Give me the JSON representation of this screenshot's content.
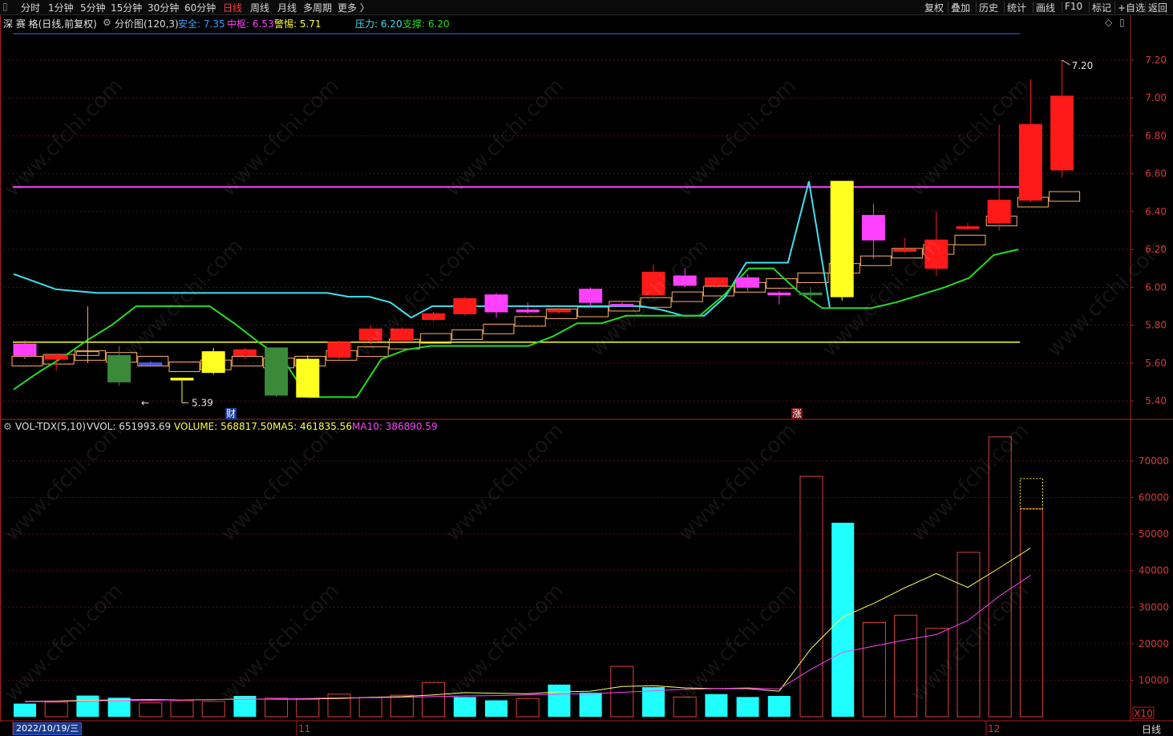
{
  "toolbar": {
    "left_items": [
      "分时",
      "1分钟",
      "5分钟",
      "15分钟",
      "30分钟",
      "60分钟",
      "日线",
      "周线",
      "月线",
      "多周期",
      "更多 〉"
    ],
    "active_item": "日线",
    "right_items": [
      "复权",
      "叠加",
      "历史",
      "统计",
      "画线",
      "F10",
      "标记",
      "+自选",
      "返回"
    ]
  },
  "main_header": {
    "stock": "深 赛 格(日线,前复权)",
    "indicator": "分价图(120,3)",
    "safe_label": "安全: 7.35",
    "mid_label": "中枢: 6.53",
    "warn_label": "警惕: 5.71",
    "pressure_label": "压力: 6.20",
    "support_label": "支撑: 6.20"
  },
  "vol_header": {
    "name": "VOL-TDX(5,10)",
    "vvol": "VVOL: 651993.69",
    "volume": "VOLUME: 568817.50",
    "ma5": "MA5: 461835.56",
    "ma10": "MA10: 386890.59"
  },
  "annotations": {
    "high_label": "7.20",
    "low_label": "5.39",
    "fin_marker": "财",
    "up_marker": "涨"
  },
  "price_axis": [
    "7.20",
    "7.00",
    "6.80",
    "6.60",
    "6.40",
    "6.20",
    "6.00",
    "5.80",
    "5.60",
    "5.40"
  ],
  "volume_axis": [
    "70000",
    "60000",
    "50000",
    "40000",
    "30000",
    "20000",
    "10000"
  ],
  "volume_unit": "X10",
  "date_box": "2022/10/19/三",
  "month_labels": [
    "11",
    "12"
  ],
  "period_label": "日线",
  "watermark": "www.cfchi.com",
  "colors": {
    "up": "#ff1a1a",
    "down": "#3a8a3a",
    "magenta": "#ff40ff",
    "yellow": "#ffff20",
    "cyan": "#20ffff",
    "green_line": "#22dd22",
    "cyan_line": "#40e0f0",
    "axis_red": "#d63a3a"
  },
  "chart_data": {
    "type": "candlestick",
    "price": {
      "ylim": [
        5.3,
        7.4
      ],
      "candles": [
        {
          "open": 5.7,
          "close": 5.64,
          "high": 5.72,
          "low": 5.62,
          "color": "magenta"
        },
        {
          "open": 5.64,
          "close": 5.62,
          "high": 5.65,
          "low": 5.56,
          "color": "red"
        },
        {
          "open": 5.64,
          "close": 5.66,
          "high": 5.9,
          "low": 5.6,
          "color": "outline"
        },
        {
          "open": 5.64,
          "close": 5.5,
          "high": 5.69,
          "low": 5.48,
          "color": "green"
        },
        {
          "open": 5.6,
          "close": 5.59,
          "high": 5.61,
          "low": 5.58,
          "color": "blue"
        },
        {
          "open": 5.52,
          "close": 5.51,
          "high": 5.52,
          "low": 5.39,
          "color": "yellow"
        },
        {
          "open": 5.55,
          "close": 5.66,
          "high": 5.68,
          "low": 5.54,
          "color": "yellow"
        },
        {
          "open": 5.64,
          "close": 5.67,
          "high": 5.68,
          "low": 5.62,
          "color": "red"
        },
        {
          "open": 5.68,
          "close": 5.43,
          "high": 5.68,
          "low": 5.42,
          "color": "green"
        },
        {
          "open": 5.62,
          "close": 5.42,
          "high": 5.64,
          "low": 5.42,
          "color": "yellow"
        },
        {
          "open": 5.63,
          "close": 5.71,
          "high": 5.72,
          "low": 5.62,
          "color": "red"
        },
        {
          "open": 5.72,
          "close": 5.78,
          "high": 5.8,
          "low": 5.7,
          "color": "red"
        },
        {
          "open": 5.72,
          "close": 5.78,
          "high": 5.79,
          "low": 5.72,
          "color": "red"
        },
        {
          "open": 5.83,
          "close": 5.86,
          "high": 5.87,
          "low": 5.82,
          "color": "red"
        },
        {
          "open": 5.86,
          "close": 5.94,
          "high": 5.95,
          "low": 5.85,
          "color": "red"
        },
        {
          "open": 5.87,
          "close": 5.96,
          "high": 5.97,
          "low": 5.84,
          "color": "magenta"
        },
        {
          "open": 5.87,
          "close": 5.88,
          "high": 5.92,
          "low": 5.86,
          "color": "magenta"
        },
        {
          "open": 5.87,
          "close": 5.88,
          "high": 5.89,
          "low": 5.86,
          "color": "red"
        },
        {
          "open": 5.92,
          "close": 5.99,
          "high": 6.0,
          "low": 5.9,
          "color": "magenta"
        },
        {
          "open": 5.91,
          "close": 5.91,
          "high": 5.92,
          "low": 5.9,
          "color": "magenta"
        },
        {
          "open": 5.96,
          "close": 6.08,
          "high": 6.12,
          "low": 5.94,
          "color": "red"
        },
        {
          "open": 6.06,
          "close": 6.01,
          "high": 6.1,
          "low": 6.0,
          "color": "magenta"
        },
        {
          "open": 6.01,
          "close": 6.05,
          "high": 6.05,
          "low": 6.0,
          "color": "red"
        },
        {
          "open": 6.0,
          "close": 6.05,
          "high": 6.07,
          "low": 5.98,
          "color": "magenta"
        },
        {
          "open": 5.97,
          "close": 5.96,
          "high": 5.98,
          "low": 5.91,
          "color": "magenta"
        },
        {
          "open": 5.96,
          "close": 5.97,
          "high": 6.0,
          "low": 5.92,
          "color": "green"
        },
        {
          "open": 5.95,
          "close": 6.56,
          "high": 6.56,
          "low": 5.93,
          "color": "yellow"
        },
        {
          "open": 6.38,
          "close": 6.25,
          "high": 6.44,
          "low": 6.15,
          "color": "magenta"
        },
        {
          "open": 6.19,
          "close": 6.2,
          "high": 6.26,
          "low": 6.18,
          "color": "red"
        },
        {
          "open": 6.1,
          "close": 6.25,
          "high": 6.4,
          "low": 6.06,
          "color": "red"
        },
        {
          "open": 6.31,
          "close": 6.32,
          "high": 6.34,
          "low": 6.3,
          "color": "red"
        },
        {
          "open": 6.34,
          "close": 6.46,
          "high": 6.86,
          "low": 6.3,
          "color": "red"
        },
        {
          "open": 6.46,
          "close": 6.86,
          "high": 7.1,
          "low": 6.45,
          "color": "red"
        },
        {
          "open": 6.62,
          "close": 7.01,
          "high": 7.2,
          "low": 6.58,
          "color": "red"
        }
      ],
      "lines": {
        "magenta_level": 6.53,
        "yellow_level": 5.71,
        "blue_level": 7.35,
        "green_line": [
          5.46,
          5.55,
          5.63,
          5.72,
          5.8,
          5.9,
          5.9,
          5.9,
          5.9,
          5.81,
          5.71,
          5.62,
          5.42,
          5.42,
          5.42,
          5.62,
          5.67,
          5.69,
          5.69,
          5.69,
          5.69,
          5.69,
          5.74,
          5.81,
          5.81,
          5.85,
          5.85,
          5.85,
          5.85,
          5.96,
          6.1,
          6.1,
          5.98,
          5.89,
          5.89,
          5.89,
          5.92,
          5.96,
          6.0,
          6.05,
          6.17,
          6.2
        ],
        "cyan_line": [
          6.07,
          6.03,
          5.99,
          5.98,
          5.97,
          5.97,
          5.97,
          5.97,
          5.97,
          5.97,
          5.97,
          5.97,
          5.97,
          5.97,
          5.97,
          5.97,
          5.95,
          5.95,
          5.92,
          5.84,
          5.9,
          5.9,
          5.9,
          5.9,
          5.9,
          5.9,
          5.9,
          5.9,
          5.9,
          5.9,
          5.9,
          5.88,
          5.85,
          5.85,
          5.95,
          6.13,
          6.13,
          6.13,
          6.56,
          5.89
        ]
      },
      "steps": [
        5.61,
        5.62,
        5.64,
        5.63,
        5.61,
        5.58,
        5.59,
        5.61,
        5.6,
        5.61,
        5.64,
        5.66,
        5.7,
        5.73,
        5.75,
        5.78,
        5.82,
        5.86,
        5.87,
        5.9,
        5.92,
        5.95,
        5.98,
        6.0,
        6.02,
        6.05,
        6.1,
        6.14,
        6.18,
        6.2,
        6.25,
        6.35,
        6.45,
        6.48
      ]
    },
    "volume": {
      "ylim": [
        0,
        80000
      ],
      "bars": [
        {
          "v": 3600,
          "color": "cyan"
        },
        {
          "v": 4000,
          "color": "red_outline"
        },
        {
          "v": 5800,
          "color": "cyan"
        },
        {
          "v": 5200,
          "color": "cyan"
        },
        {
          "v": 3800,
          "color": "red_outline"
        },
        {
          "v": 4400,
          "color": "red_outline"
        },
        {
          "v": 4200,
          "color": "red_outline"
        },
        {
          "v": 5700,
          "color": "cyan"
        },
        {
          "v": 5100,
          "color": "red_outline"
        },
        {
          "v": 4800,
          "color": "red_outline"
        },
        {
          "v": 6200,
          "color": "red_outline"
        },
        {
          "v": 5300,
          "color": "red_outline"
        },
        {
          "v": 5900,
          "color": "red_outline"
        },
        {
          "v": 9400,
          "color": "red_outline"
        },
        {
          "v": 5400,
          "color": "cyan"
        },
        {
          "v": 4500,
          "color": "cyan"
        },
        {
          "v": 5000,
          "color": "red_outline"
        },
        {
          "v": 8800,
          "color": "cyan"
        },
        {
          "v": 6600,
          "color": "cyan"
        },
        {
          "v": 13800,
          "color": "red_outline"
        },
        {
          "v": 8100,
          "color": "cyan"
        },
        {
          "v": 5400,
          "color": "red_outline"
        },
        {
          "v": 6200,
          "color": "cyan"
        },
        {
          "v": 5400,
          "color": "cyan"
        },
        {
          "v": 5700,
          "color": "cyan"
        },
        {
          "v": 65800,
          "color": "red_outline"
        },
        {
          "v": 53100,
          "color": "cyan"
        },
        {
          "v": 25800,
          "color": "red_outline"
        },
        {
          "v": 27800,
          "color": "red_outline"
        },
        {
          "v": 24200,
          "color": "red_outline"
        },
        {
          "v": 45000,
          "color": "red_outline"
        },
        {
          "v": 76600,
          "color": "red_outline"
        },
        {
          "v": 56900,
          "color": "red_outline"
        }
      ],
      "ma5": [
        4200,
        4300,
        4500,
        4600,
        4700,
        4600,
        4700,
        4900,
        4800,
        4900,
        5000,
        5300,
        5500,
        6000,
        6600,
        6400,
        6300,
        6800,
        7000,
        8300,
        8500,
        7900,
        7700,
        7700,
        7000,
        18500,
        27200,
        31000,
        35300,
        39200,
        35400,
        40700,
        46200
      ],
      "ma10": [
        4100,
        4200,
        4300,
        4400,
        4500,
        4600,
        4700,
        4800,
        4900,
        5000,
        5200,
        5200,
        5300,
        5500,
        5700,
        5800,
        6000,
        6200,
        6300,
        6700,
        7100,
        7500,
        7700,
        7900,
        7600,
        12900,
        17600,
        19300,
        21000,
        22500,
        26300,
        33000,
        38700
      ],
      "last_projected": 65200
    }
  }
}
